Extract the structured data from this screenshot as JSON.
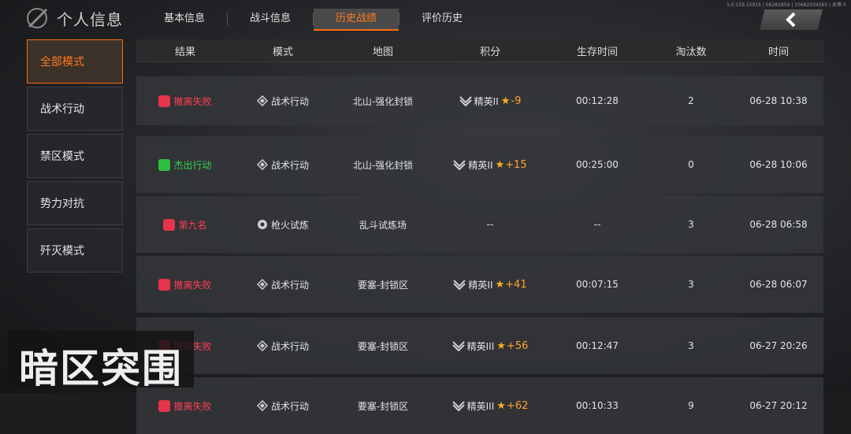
{
  "header": {
    "title": "个人信息",
    "tabs": [
      "基本信息",
      "战斗信息",
      "历史战绩",
      "评价历史"
    ],
    "active_tab": "历史战绩",
    "top_info": "1.0.159.15915 | 06281854 | 10682204565 | 总第-5"
  },
  "sidebar": {
    "items": [
      "全部模式",
      "战术行动",
      "禁区模式",
      "势力对抗",
      "歼灭模式"
    ],
    "active": "全部模式"
  },
  "table": {
    "columns": [
      "结果",
      "模式",
      "地图",
      "积分",
      "生存时间",
      "淘汰数",
      "时间"
    ],
    "rows": [
      {
        "result": "撤离失败",
        "mode": "战术行动",
        "map": "北山-强化封锁",
        "rank": "精英II",
        "score": "-9",
        "survive": "00:12:28",
        "kills": "2",
        "time": "06-28 10:38"
      },
      {
        "result": "杰出行动",
        "mode": "战术行动",
        "map": "北山-强化封锁",
        "rank": "精英II",
        "score": "+15",
        "survive": "00:25:00",
        "kills": "0",
        "time": "06-28 10:06"
      },
      {
        "result": "第九名",
        "mode": "枪火试炼",
        "map": "乱斗试炼场",
        "rank": "--",
        "score": "",
        "survive": "--",
        "kills": "3",
        "time": "06-28 06:58"
      },
      {
        "result": "撤离失败",
        "mode": "战术行动",
        "map": "要塞-封锁区",
        "rank": "精英II",
        "score": "+41",
        "survive": "00:07:15",
        "kills": "3",
        "time": "06-28 06:07"
      },
      {
        "result": "撤离失败",
        "mode": "战术行动",
        "map": "要塞-封锁区",
        "rank": "精英III",
        "score": "+56",
        "survive": "00:12:47",
        "kills": "3",
        "time": "06-27 20:26"
      },
      {
        "result": "撤离失败",
        "mode": "战术行动",
        "map": "要塞-封锁区",
        "rank": "精英III",
        "score": "+62",
        "survive": "00:10:33",
        "kills": "9",
        "time": "06-27 20:12"
      }
    ]
  },
  "watermark": "暗区突围",
  "colors": {
    "accent": "#ff6a10",
    "fail": "#ff3f56",
    "success": "#38d24d",
    "star": "#ffb020"
  }
}
